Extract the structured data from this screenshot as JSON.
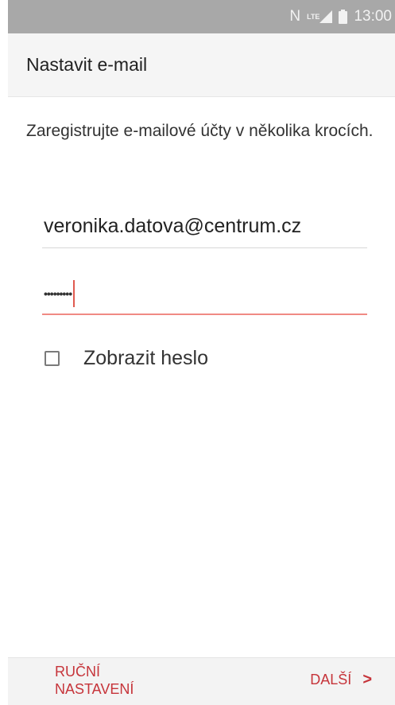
{
  "status_bar": {
    "nfc_icon": "N",
    "network": "LTE",
    "signal_icon": "signal-icon",
    "battery_icon": "battery-icon",
    "time": "13:00"
  },
  "header": {
    "title": "Nastavit e-mail"
  },
  "form": {
    "description": "Zaregistrujte e-mailové účty v několika krocích.",
    "email_value": "veronika.datova@centrum.cz",
    "password_mask": "•••••••••",
    "show_password_label": "Zobrazit heslo",
    "show_password_checked": false
  },
  "footer": {
    "manual_setup_label": "RUČNÍ NASTAVENÍ",
    "next_label": "DALŠÍ",
    "next_chevron": ">"
  },
  "colors": {
    "accent": "#c6343a",
    "active_underline": "#f08a84",
    "status_bar": "#a8a8a8"
  }
}
